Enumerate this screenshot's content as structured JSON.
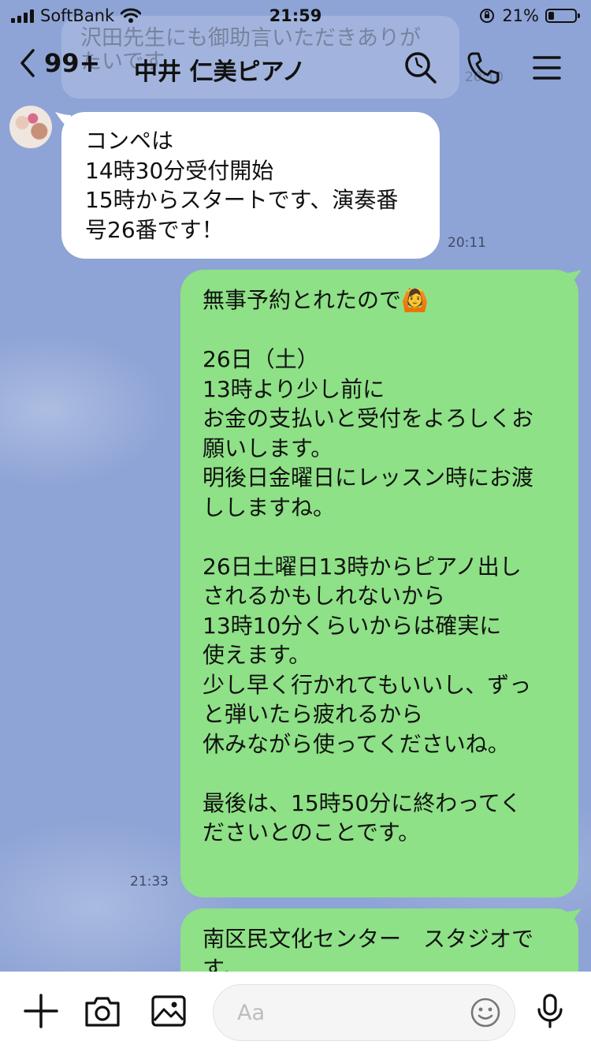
{
  "status_bar": {
    "carrier": "SoftBank",
    "time": "21:59",
    "battery_percent": "21%",
    "battery_level": 0.21
  },
  "ghost_notification": {
    "text": "沢田先生にも御助言いただきありがたいです",
    "time": "20:10"
  },
  "header": {
    "unread_count": "99+",
    "chat_title": "中井 仁美ピアノ"
  },
  "messages": [
    {
      "direction": "received",
      "lines": [
        "コンペは",
        "14時30分受付開始",
        "15時からスタートです、演奏番",
        "号26番です！"
      ],
      "time": "20:11"
    },
    {
      "direction": "sent",
      "lines": [
        "無事予約とれたので🙆",
        "",
        "26日（土）",
        "13時より少し前に",
        "お金の支払いと受付をよろしくお",
        "願いします。",
        "明後日金曜日にレッスン時にお渡",
        "ししますね。",
        "",
        "26日土曜日13時からピアノ出し",
        "されるかもしれないから",
        "13時10分くらいからは確実に",
        "使えます。",
        "少し早く行かれてもいいし、ずっ",
        "と弾いたら疲れるから",
        "休みながら使ってくださいね。",
        "",
        "最後は、15時50分に終わってく",
        "ださいとのことです。"
      ],
      "time": "21:33"
    },
    {
      "direction": "sent",
      "lines": [
        "南区民文化センター　スタジオで",
        "す。"
      ],
      "time": ""
    }
  ],
  "composer": {
    "placeholder": "Aa"
  },
  "colors": {
    "background": "#8ea4d6",
    "sent_bubble": "#8ee186",
    "received_bubble": "#ffffff"
  },
  "icons": [
    "back-chevron-icon",
    "search-icon",
    "phone-icon",
    "menu-icon",
    "plus-icon",
    "camera-icon",
    "image-icon",
    "emoji-icon",
    "microphone-icon"
  ]
}
